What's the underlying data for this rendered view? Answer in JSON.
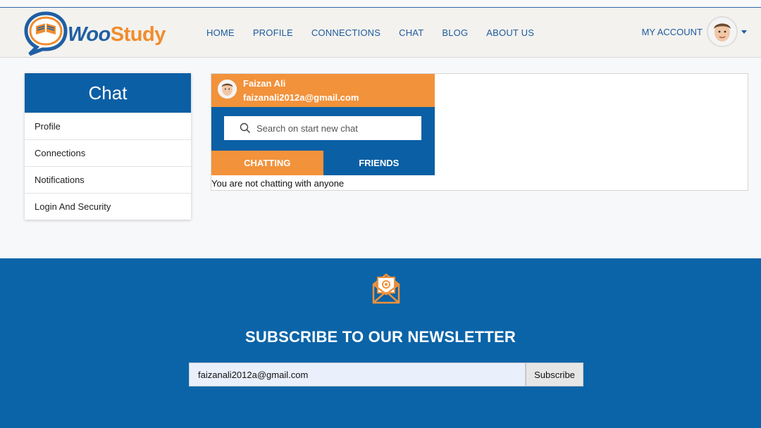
{
  "brand": {
    "logo_text_1": "Woo",
    "logo_text_2": "Study",
    "orange": "#f08c2e",
    "blue": "#0b5fa5"
  },
  "nav": {
    "items": [
      {
        "label": "HOME"
      },
      {
        "label": "PROFILE"
      },
      {
        "label": "CONNECTIONS"
      },
      {
        "label": "CHAT"
      },
      {
        "label": "BLOG"
      },
      {
        "label": "ABOUT US"
      }
    ],
    "account_label": "MY ACCOUNT"
  },
  "sidebar": {
    "title": "Chat",
    "items": [
      {
        "label": "Profile"
      },
      {
        "label": "Connections"
      },
      {
        "label": "Notifications"
      },
      {
        "label": "Login And Security"
      }
    ]
  },
  "chat": {
    "user_name": "Faizan Ali",
    "user_email": "faizanali2012a@gmail.com",
    "search_placeholder": "Search on start new chat",
    "tabs": [
      {
        "label": "CHATTING"
      },
      {
        "label": "FRIENDS"
      }
    ],
    "active_tab": "CHATTING",
    "empty_message": "You are not chatting with anyone"
  },
  "newsletter": {
    "title_part1": "SUBSCRIBE TO OUR ",
    "title_part2": "NEWSLETTER",
    "email_value": "faizanali2012a@gmail.com",
    "button_label": "Subscribe"
  }
}
